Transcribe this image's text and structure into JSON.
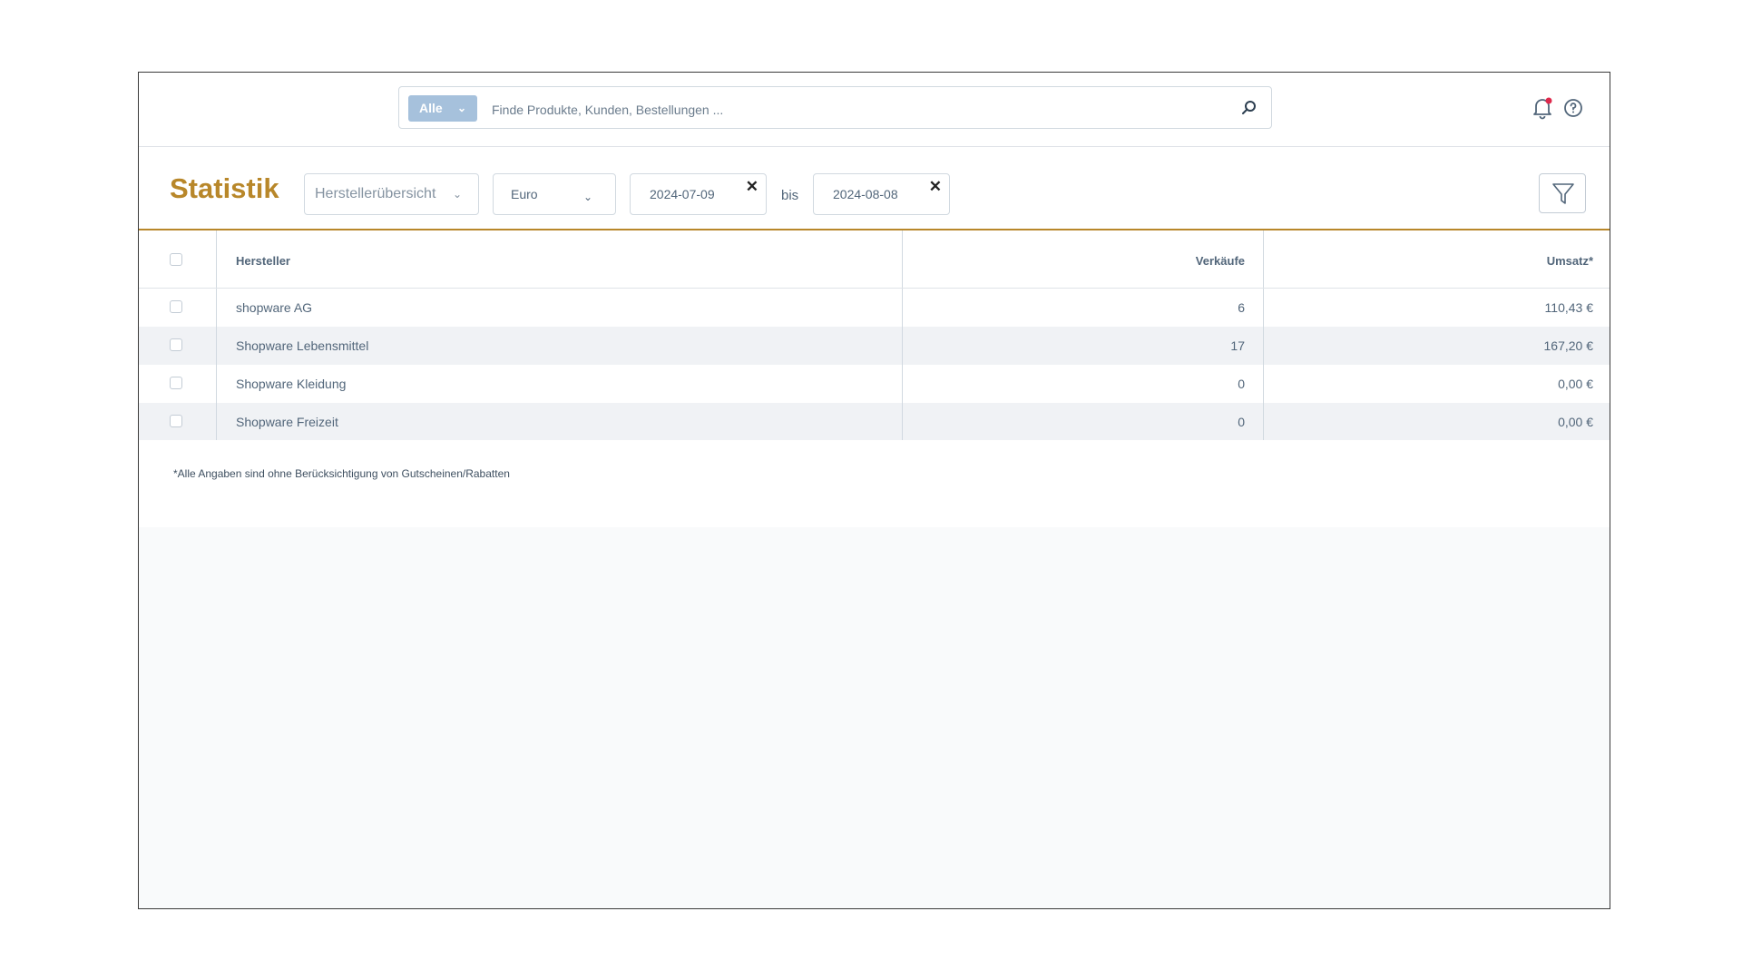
{
  "search": {
    "type_label": "Alle",
    "placeholder": "Finde Produkte, Kunden, Bestellungen ..."
  },
  "header": {
    "title": "Statistik",
    "report_select": "Herstellerübersicht",
    "currency_select": "Euro",
    "date_from": "2024-07-09",
    "date_separator": "bis",
    "date_to": "2024-08-08",
    "clear_symbol": "✕"
  },
  "icons": {
    "search": "search-icon",
    "notifications": "bell-icon",
    "help": "help-icon",
    "filter": "filter-icon"
  },
  "colors": {
    "accent": "#b8872a",
    "notification_dot": "#de294c",
    "chip": "#a6c1dc"
  },
  "table": {
    "columns": [
      "Hersteller",
      "Verkäufe",
      "Umsatz*"
    ],
    "rows": [
      {
        "name": "shopware AG",
        "sales": "6",
        "revenue": "110,43 €"
      },
      {
        "name": "Shopware Lebensmittel",
        "sales": "17",
        "revenue": "167,20 €"
      },
      {
        "name": "Shopware Kleidung",
        "sales": "0",
        "revenue": "0,00 €"
      },
      {
        "name": "Shopware Freizeit",
        "sales": "0",
        "revenue": "0,00 €"
      }
    ]
  },
  "footnote": "*Alle Angaben sind ohne Berücksichtigung von Gutscheinen/Rabatten"
}
